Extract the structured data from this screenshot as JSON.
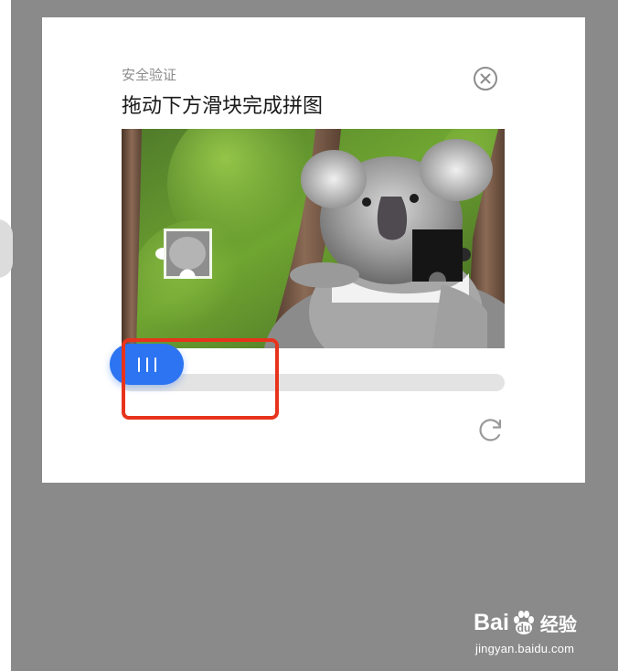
{
  "captcha": {
    "subtitle": "安全验证",
    "title": "拖动下方滑块完成拼图",
    "accent_color": "#2c74f1",
    "highlight_color": "#e8331c"
  },
  "icons": {
    "close": "close-circle-icon",
    "refresh": "refresh-icon",
    "slider_grip": "grip-lines-icon"
  },
  "puzzle": {
    "image": "koala on a tree branch"
  },
  "watermark": {
    "logo_latin_a": "Bai",
    "logo_latin_b": "u",
    "logo_cn": "经验",
    "url": "jingyan.baidu.com"
  }
}
